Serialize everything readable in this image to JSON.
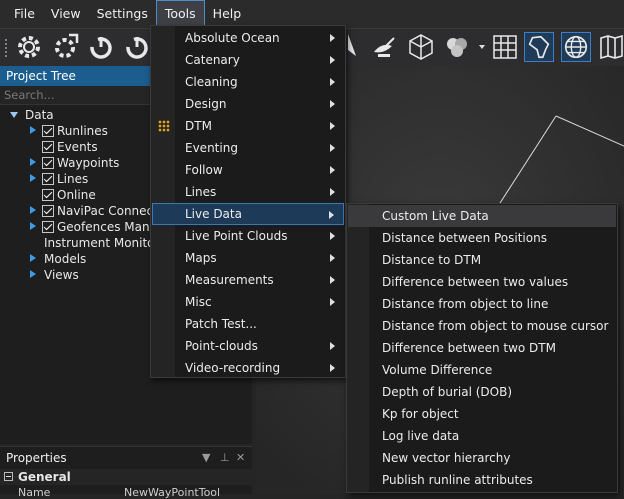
{
  "menubar": {
    "items": [
      "File",
      "View",
      "Settings",
      "Tools",
      "Help"
    ],
    "active": "Tools"
  },
  "toolbar": {
    "icons": [
      "gear-icon",
      "gear-arrow-icon",
      "power-gear-icon",
      "power-gear-icon",
      "north-arrow-icon",
      "satellite-dish-icon",
      "cube-icon",
      "circles-icon",
      "grid-icon",
      "africa-map-icon",
      "globe-icon",
      "book-map-icon"
    ]
  },
  "project_tree": {
    "title": "Project Tree",
    "search_placeholder": "Search...",
    "root": "Data",
    "items": [
      "Runlines",
      "Events",
      "Waypoints",
      "Lines",
      "Online",
      "NaviPac Connections",
      "Geofences Manager",
      "Instrument Monitor"
    ],
    "sections": [
      "Models",
      "Views"
    ]
  },
  "properties": {
    "title": "Properties",
    "group": "General",
    "row_label": "Name",
    "row_value": "NewWayPointTool"
  },
  "tools_menu": {
    "items": [
      {
        "label": "Absolute Ocean",
        "submenu": true
      },
      {
        "label": "Catenary",
        "submenu": true
      },
      {
        "label": "Cleaning",
        "submenu": true
      },
      {
        "label": "Design",
        "submenu": true
      },
      {
        "label": "DTM",
        "submenu": true
      },
      {
        "label": "Eventing",
        "submenu": true
      },
      {
        "label": "Follow",
        "submenu": true
      },
      {
        "label": "Lines",
        "submenu": true
      },
      {
        "label": "Live Data",
        "submenu": true
      },
      {
        "label": "Live Point Clouds",
        "submenu": true
      },
      {
        "label": "Maps",
        "submenu": true
      },
      {
        "label": "Measurements",
        "submenu": true
      },
      {
        "label": "Misc",
        "submenu": true
      },
      {
        "label": "Patch Test...",
        "submenu": false
      },
      {
        "label": "Point-clouds",
        "submenu": true
      },
      {
        "label": "Video-recording",
        "submenu": true
      }
    ],
    "active": "Live Data"
  },
  "live_data_menu": {
    "items": [
      "Custom Live Data",
      "Distance between Positions",
      "Distance to DTM",
      "Difference between two values",
      "Distance from object to line",
      "Distance from object to mouse cursor",
      "Difference between two DTM",
      "Volume Difference",
      "Depth of burial (DOB)",
      "Kp for object",
      "Log live data",
      "New vector hierarchy",
      "Publish runline attributes"
    ],
    "hovered": "Custom Live Data"
  },
  "colors": {
    "accent": "#1c5d8f",
    "menu_highlight": "#1d3a58",
    "checkbox_accent": "#3d9ae6",
    "tree_icon": "#e3a21a"
  }
}
